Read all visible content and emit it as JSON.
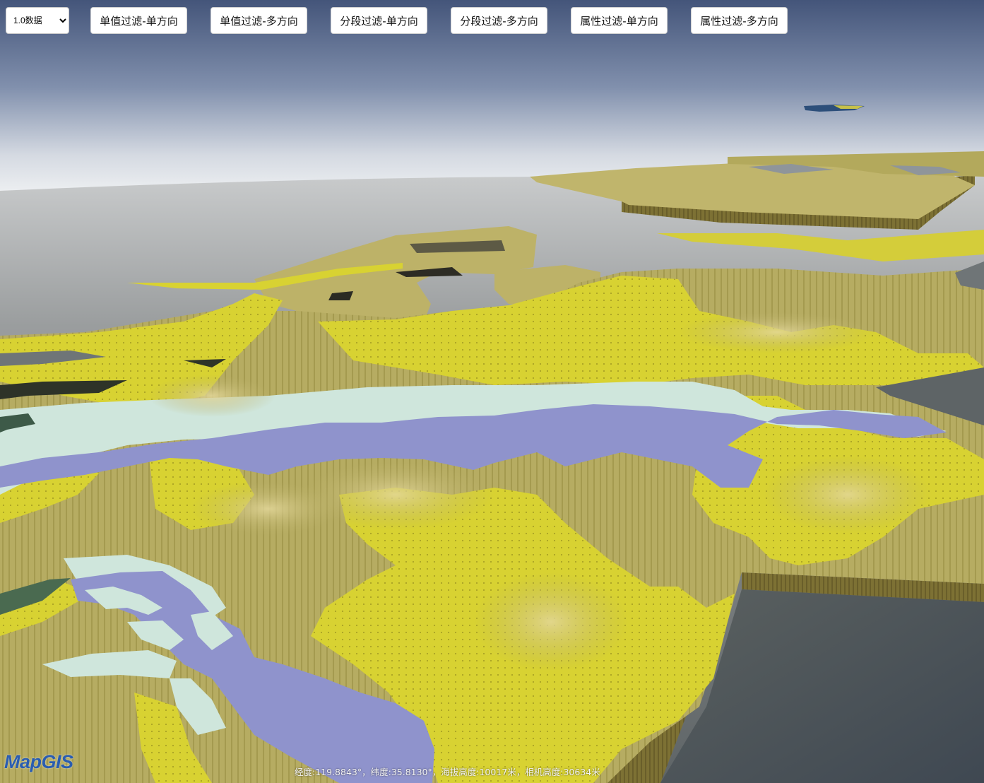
{
  "toolbar": {
    "data_select": {
      "selected": "1.0数据",
      "options": [
        "1.0数据"
      ]
    },
    "buttons": [
      {
        "label": "单值过滤-单方向"
      },
      {
        "label": "单值过滤-多方向"
      },
      {
        "label": "分段过滤-单方向"
      },
      {
        "label": "分段过滤-多方向"
      },
      {
        "label": "属性过滤-单方向"
      },
      {
        "label": "属性过滤-多方向"
      }
    ]
  },
  "logo": {
    "text": "MapGIS"
  },
  "status": {
    "text": "经度:119.8843°，纬度:35.8130°，海拔高度:10017米，相机高度:30634米",
    "longitude": "119.8843°",
    "latitude": "35.8130°",
    "altitude": "10017米",
    "camera_height": "30634米"
  },
  "colors": {
    "sky_top": "#44557a",
    "horizon": "#eef0f2",
    "water": "#6d7274",
    "terrain_olive": "#b6ac62",
    "geology_yellow": "#d8d232",
    "geology_blue": "#8f93cc",
    "geology_pale": "#cfe6dc",
    "cliff_brown": "#7b6f32"
  }
}
